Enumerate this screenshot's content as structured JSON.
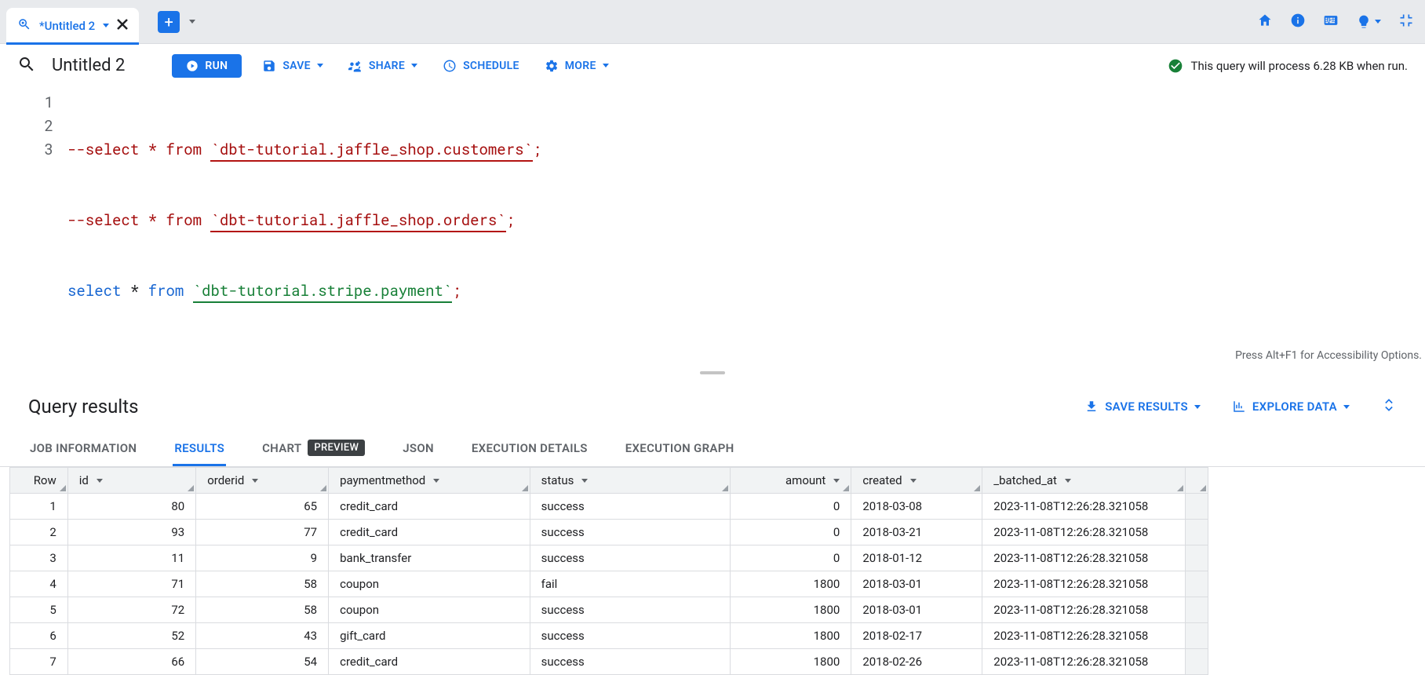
{
  "tabbar": {
    "tab_title": "*Untitled 2"
  },
  "toolbar": {
    "title": "Untitled 2",
    "run_label": "RUN",
    "save_label": "SAVE",
    "share_label": "SHARE",
    "schedule_label": "SCHEDULE",
    "more_label": "MORE"
  },
  "status_text": "This query will process 6.28 KB when run.",
  "editor": {
    "lines": [
      {
        "num": "1",
        "type": "comment_line",
        "prefix": "--select * from ",
        "table": "`dbt-tutorial.jaffle_shop.customers`",
        "suffix": ";"
      },
      {
        "num": "2",
        "type": "comment_line",
        "prefix": "--select * from ",
        "table": "`dbt-tutorial.jaffle_shop.orders`",
        "suffix": ";"
      },
      {
        "num": "3",
        "type": "active_line",
        "kw": "select",
        "mid": " * ",
        "kw2": "from",
        "sp": " ",
        "table": "`dbt-tutorial.stripe.payment`",
        "suffix": ";"
      }
    ],
    "accessibility": "Press Alt+F1 for Accessibility Options."
  },
  "results": {
    "title": "Query results",
    "save_label": "SAVE RESULTS",
    "explore_label": "EXPLORE DATA",
    "tabs": {
      "job_info": "JOB INFORMATION",
      "results": "RESULTS",
      "chart": "CHART",
      "preview_badge": "PREVIEW",
      "json": "JSON",
      "exec_details": "EXECUTION DETAILS",
      "exec_graph": "EXECUTION GRAPH"
    },
    "columns": {
      "row": "Row",
      "id": "id",
      "orderid": "orderid",
      "paymentmethod": "paymentmethod",
      "status": "status",
      "amount": "amount",
      "created": "created",
      "batched": "_batched_at"
    },
    "rows": [
      {
        "row": "1",
        "id": "80",
        "orderid": "65",
        "paymentmethod": "credit_card",
        "status": "success",
        "amount": "0",
        "created": "2018-03-08",
        "batched": "2023-11-08T12:26:28.321058"
      },
      {
        "row": "2",
        "id": "93",
        "orderid": "77",
        "paymentmethod": "credit_card",
        "status": "success",
        "amount": "0",
        "created": "2018-03-21",
        "batched": "2023-11-08T12:26:28.321058"
      },
      {
        "row": "3",
        "id": "11",
        "orderid": "9",
        "paymentmethod": "bank_transfer",
        "status": "success",
        "amount": "0",
        "created": "2018-01-12",
        "batched": "2023-11-08T12:26:28.321058"
      },
      {
        "row": "4",
        "id": "71",
        "orderid": "58",
        "paymentmethod": "coupon",
        "status": "fail",
        "amount": "1800",
        "created": "2018-03-01",
        "batched": "2023-11-08T12:26:28.321058"
      },
      {
        "row": "5",
        "id": "72",
        "orderid": "58",
        "paymentmethod": "coupon",
        "status": "success",
        "amount": "1800",
        "created": "2018-03-01",
        "batched": "2023-11-08T12:26:28.321058"
      },
      {
        "row": "6",
        "id": "52",
        "orderid": "43",
        "paymentmethod": "gift_card",
        "status": "success",
        "amount": "1800",
        "created": "2018-02-17",
        "batched": "2023-11-08T12:26:28.321058"
      },
      {
        "row": "7",
        "id": "66",
        "orderid": "54",
        "paymentmethod": "credit_card",
        "status": "success",
        "amount": "1800",
        "created": "2018-02-26",
        "batched": "2023-11-08T12:26:28.321058"
      }
    ]
  }
}
